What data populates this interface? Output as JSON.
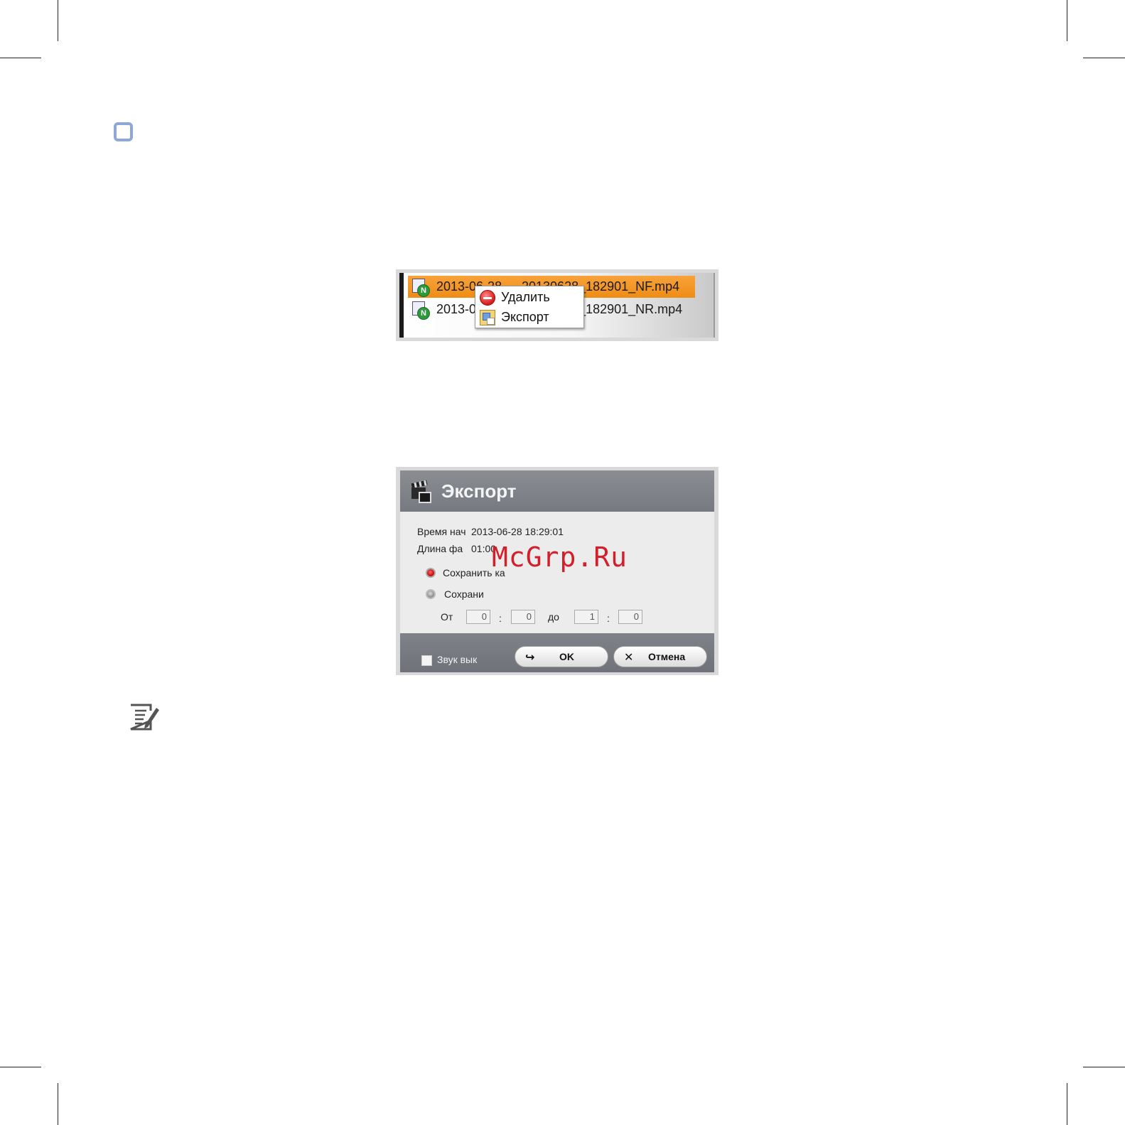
{
  "file_list": {
    "rows": [
      {
        "date": "2013-06-28",
        "filename": "20130628_182901_NF.mp4",
        "badge": "N",
        "selected": true
      },
      {
        "date": "2013-06-28",
        "filename": "20130628_182901_NR.mp4",
        "badge": "N",
        "selected": false
      }
    ],
    "context_menu": [
      {
        "label": "Удалить",
        "icon": "delete-icon"
      },
      {
        "label": "Экспорт",
        "icon": "export-icon"
      }
    ]
  },
  "export_dialog": {
    "title": "Экспорт",
    "start_time_label": "Время нач",
    "start_time_value": "2013-06-28 18:29:01",
    "length_label": "Длина фа",
    "length_value": "01:00",
    "option_save_all": "Сохранить ка",
    "option_save_range": "Сохрани",
    "range_from_label": "От",
    "range_to_label": "до",
    "range_sep": ":",
    "from_min": "0",
    "from_sec": "0",
    "to_min": "1",
    "to_sec": "0",
    "mute_label": "Звук вык",
    "ok_label": "OK",
    "cancel_label": "Отмена"
  },
  "watermark": "McGrp.Ru",
  "colors": {
    "selection": "#f29a27",
    "dialog_header": "#7e8187",
    "accent_mark": "#8fa6d8",
    "watermark": "#d21f2b"
  }
}
